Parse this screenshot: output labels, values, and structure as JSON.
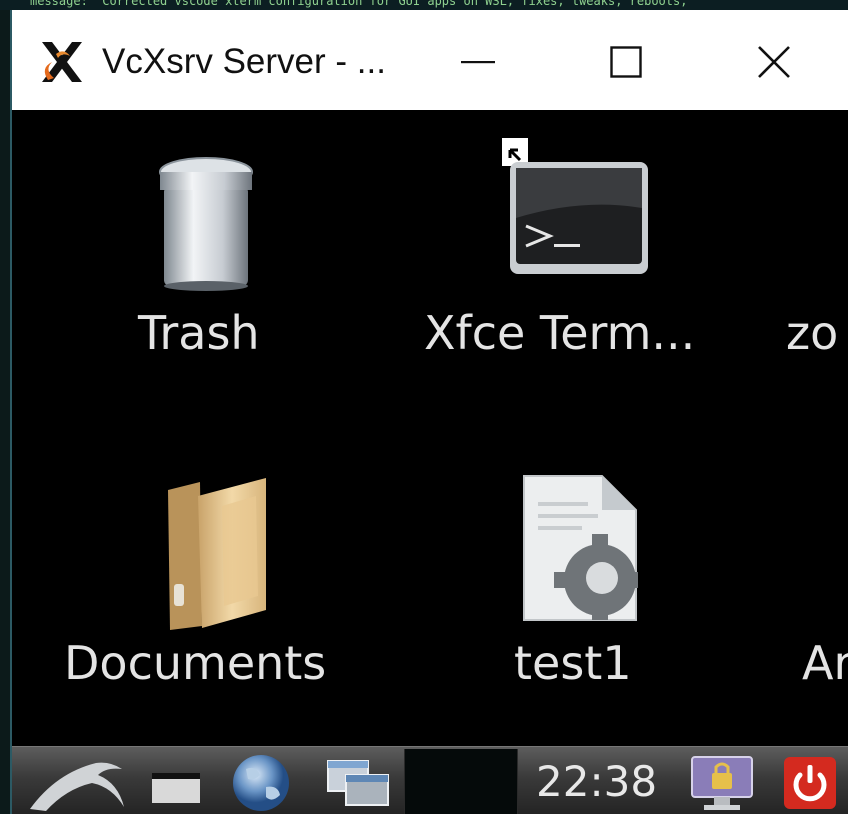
{
  "background_terminal": {
    "text": "message: 'Corrected vscode xterm configuration for GUI apps on WSL, fixes, tweaks, reboots,"
  },
  "window": {
    "title": "VcXsrv Server - ...",
    "controls": {
      "minimize": "minimize-icon",
      "maximize": "maximize-icon",
      "close": "close-icon"
    }
  },
  "desktop": {
    "icons": [
      {
        "label": "Trash",
        "icon": "trash-icon"
      },
      {
        "label": "Xfce Term...",
        "icon": "terminal-icon"
      },
      {
        "label": "zo",
        "icon": "partially-visible-icon"
      },
      {
        "label": "Documents",
        "icon": "folder-icon"
      },
      {
        "label": "test1",
        "icon": "executable-file-icon"
      },
      {
        "label": "Ar",
        "icon": "partially-visible-icon"
      }
    ]
  },
  "taskbar": {
    "clock": "22:38",
    "items": [
      "kali-menu-icon",
      "show-desktop-icon",
      "web-browser-icon",
      "window-switcher-icon",
      "workspace-pager",
      "lock-screen-icon",
      "power-icon"
    ],
    "colors": {
      "power": "#d42a1f",
      "lock": "#7b6ca8"
    }
  }
}
